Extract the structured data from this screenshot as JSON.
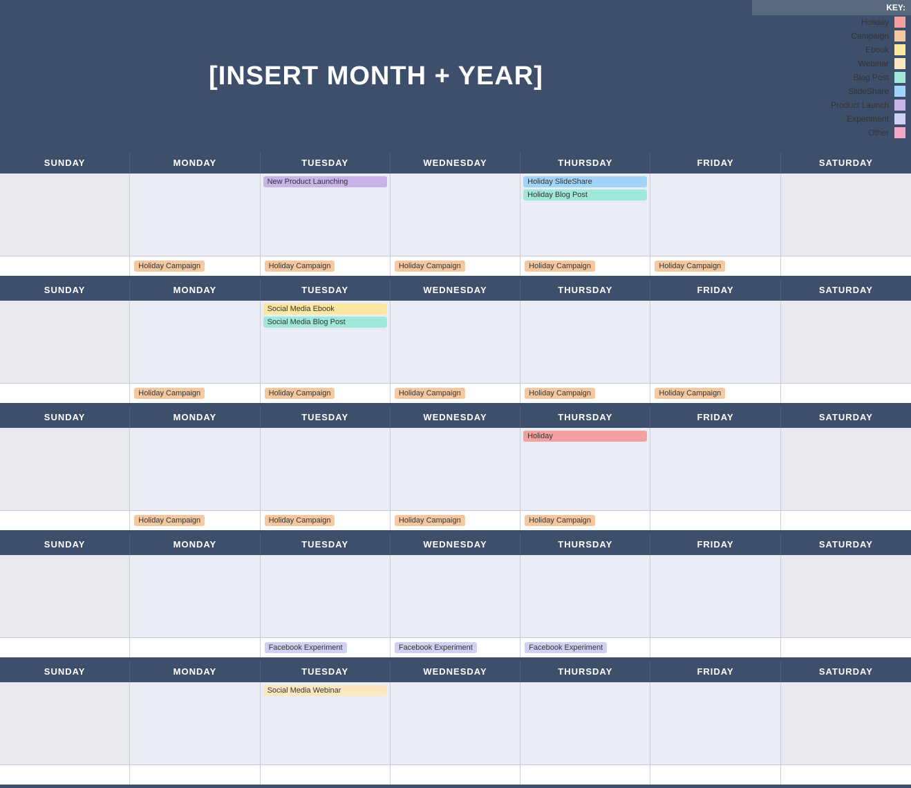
{
  "header": {
    "title": "[INSERT MONTH + YEAR]"
  },
  "key": {
    "header": "KEY:",
    "items": [
      {
        "label": "Holiday",
        "color": "#f4a0a0"
      },
      {
        "label": "Campaign",
        "color": "#f4c8a0"
      },
      {
        "label": "Ebook",
        "color": "#fce8a0"
      },
      {
        "label": "Webinar",
        "color": "#fce8c0"
      },
      {
        "label": "Blog Post",
        "color": "#a0e8d8"
      },
      {
        "label": "SlideShare",
        "color": "#a0d4f8"
      },
      {
        "label": "Product Launch",
        "color": "#c8b4e8"
      },
      {
        "label": "Experiment",
        "color": "#d0d0f4"
      },
      {
        "label": "Other",
        "color": "#f4a8c8"
      }
    ]
  },
  "days": [
    "SUNDAY",
    "MONDAY",
    "TUESDAY",
    "WEDNESDAY",
    "THURSDAY",
    "FRIDAY",
    "SATURDAY"
  ],
  "weeks": [
    {
      "cells": [
        {
          "events": [],
          "bottom": ""
        },
        {
          "events": [],
          "bottom": "Holiday Campaign"
        },
        {
          "events": [
            "New Product Launching"
          ],
          "bottom": "Holiday Campaign",
          "eventTypes": [
            "productlaunch"
          ]
        },
        {
          "events": [],
          "bottom": "Holiday Campaign"
        },
        {
          "events": [
            "Holiday SlideShare",
            "Holiday Blog Post"
          ],
          "bottom": "Holiday Campaign",
          "eventTypes": [
            "slideshare",
            "blogpost"
          ]
        },
        {
          "events": [],
          "bottom": "Holiday Campaign"
        },
        {
          "events": [],
          "bottom": ""
        }
      ]
    },
    {
      "cells": [
        {
          "events": [],
          "bottom": ""
        },
        {
          "events": [],
          "bottom": "Holiday Campaign"
        },
        {
          "events": [
            "Social Media Ebook",
            "Social Media Blog Post"
          ],
          "bottom": "Holiday Campaign",
          "eventTypes": [
            "ebook",
            "blogpost"
          ]
        },
        {
          "events": [],
          "bottom": "Holiday Campaign"
        },
        {
          "events": [],
          "bottom": "Holiday Campaign"
        },
        {
          "events": [],
          "bottom": "Holiday Campaign"
        },
        {
          "events": [],
          "bottom": ""
        }
      ]
    },
    {
      "cells": [
        {
          "events": [],
          "bottom": ""
        },
        {
          "events": [],
          "bottom": "Holiday Campaign"
        },
        {
          "events": [],
          "bottom": "Holiday Campaign"
        },
        {
          "events": [],
          "bottom": "Holiday Campaign"
        },
        {
          "events": [
            "Holiday"
          ],
          "bottom": "Holiday Campaign",
          "eventTypes": [
            "holiday"
          ]
        },
        {
          "events": [],
          "bottom": ""
        },
        {
          "events": [],
          "bottom": ""
        }
      ]
    },
    {
      "cells": [
        {
          "events": [],
          "bottom": ""
        },
        {
          "events": [],
          "bottom": ""
        },
        {
          "events": [],
          "bottom": ""
        },
        {
          "events": [],
          "bottom": ""
        },
        {
          "events": [],
          "bottom": ""
        },
        {
          "events": [],
          "bottom": ""
        },
        {
          "events": [],
          "bottom": ""
        }
      ],
      "bottomLabels": [
        "",
        "",
        "Facebook Experiment",
        "Facebook Experiment",
        "Facebook Experiment",
        "",
        ""
      ]
    },
    {
      "cells": [
        {
          "events": [],
          "bottom": ""
        },
        {
          "events": [],
          "bottom": ""
        },
        {
          "events": [
            "Social Media Webinar"
          ],
          "bottom": "",
          "eventTypes": [
            "webinar"
          ]
        },
        {
          "events": [],
          "bottom": ""
        },
        {
          "events": [],
          "bottom": ""
        },
        {
          "events": [],
          "bottom": ""
        },
        {
          "events": [],
          "bottom": ""
        }
      ]
    }
  ]
}
